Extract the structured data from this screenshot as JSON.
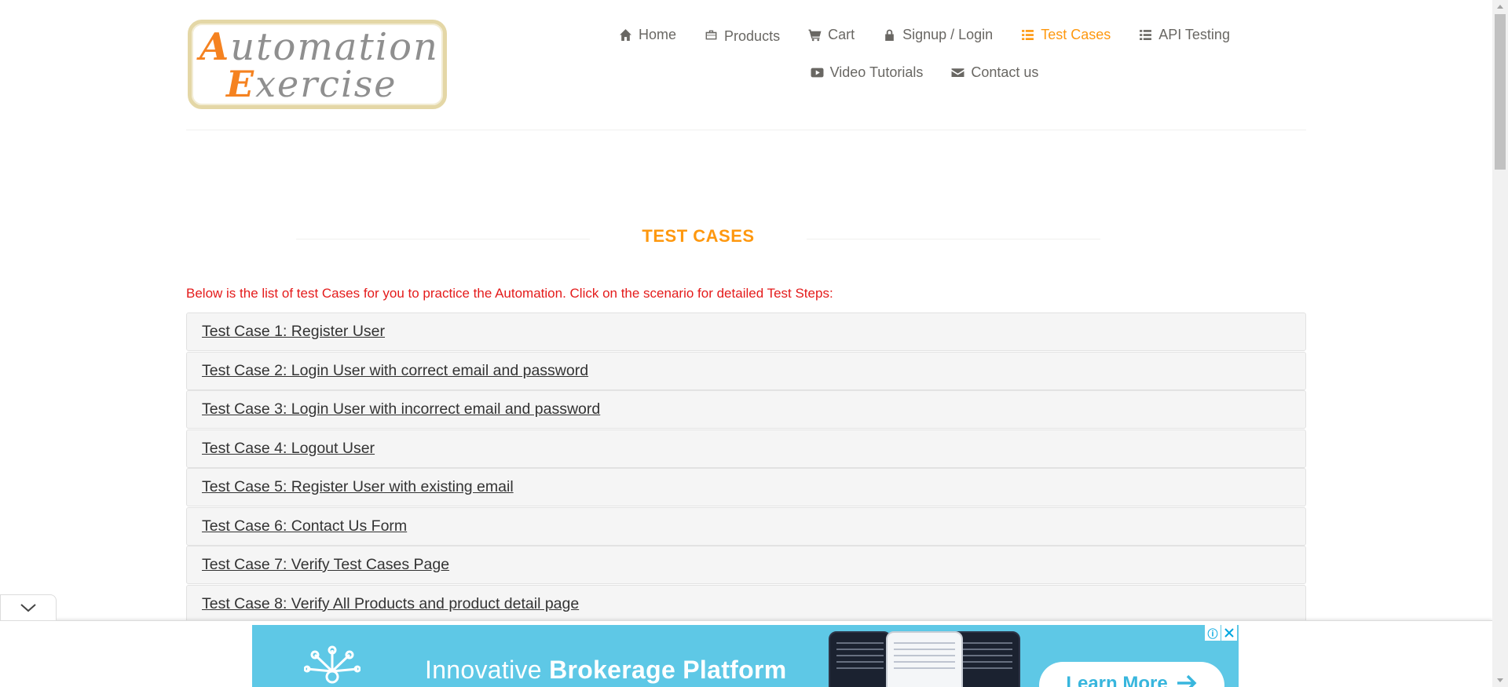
{
  "logo": {
    "line1_cap": "A",
    "line1_rest": "utomation",
    "line2_cap": "E",
    "line2_rest": "xercise"
  },
  "nav": {
    "items": [
      {
        "label": "Home",
        "icon": "home-icon"
      },
      {
        "label": "Products",
        "icon": "briefcase-icon"
      },
      {
        "label": "Cart",
        "icon": "cart-icon"
      },
      {
        "label": "Signup / Login",
        "icon": "lock-icon"
      },
      {
        "label": "Test Cases",
        "icon": "list-icon",
        "active": true
      },
      {
        "label": "API Testing",
        "icon": "list-icon"
      },
      {
        "label": "Video Tutorials",
        "icon": "youtube-icon"
      },
      {
        "label": "Contact us",
        "icon": "envelope-icon"
      }
    ]
  },
  "page": {
    "title": "TEST CASES",
    "intro": "Below is the list of test Cases for you to practice the Automation. Click on the scenario for detailed Test Steps:"
  },
  "test_cases": [
    "Test Case 1: Register User",
    "Test Case 2: Login User with correct email and password",
    "Test Case 3: Login User with incorrect email and password",
    "Test Case 4: Logout User",
    "Test Case 5: Register User with existing email",
    "Test Case 6: Contact Us Form",
    "Test Case 7: Verify Test Cases Page",
    "Test Case 8: Verify All Products and product detail page"
  ],
  "ad": {
    "text_regular": "Innovative ",
    "text_bold": "Brokerage Platform",
    "button_label": "Learn More",
    "info_glyph": "ⓘ"
  },
  "colors": {
    "accent": "#fe980f",
    "intro_text": "#e41b1b",
    "ad_background": "#5ec8e6"
  }
}
